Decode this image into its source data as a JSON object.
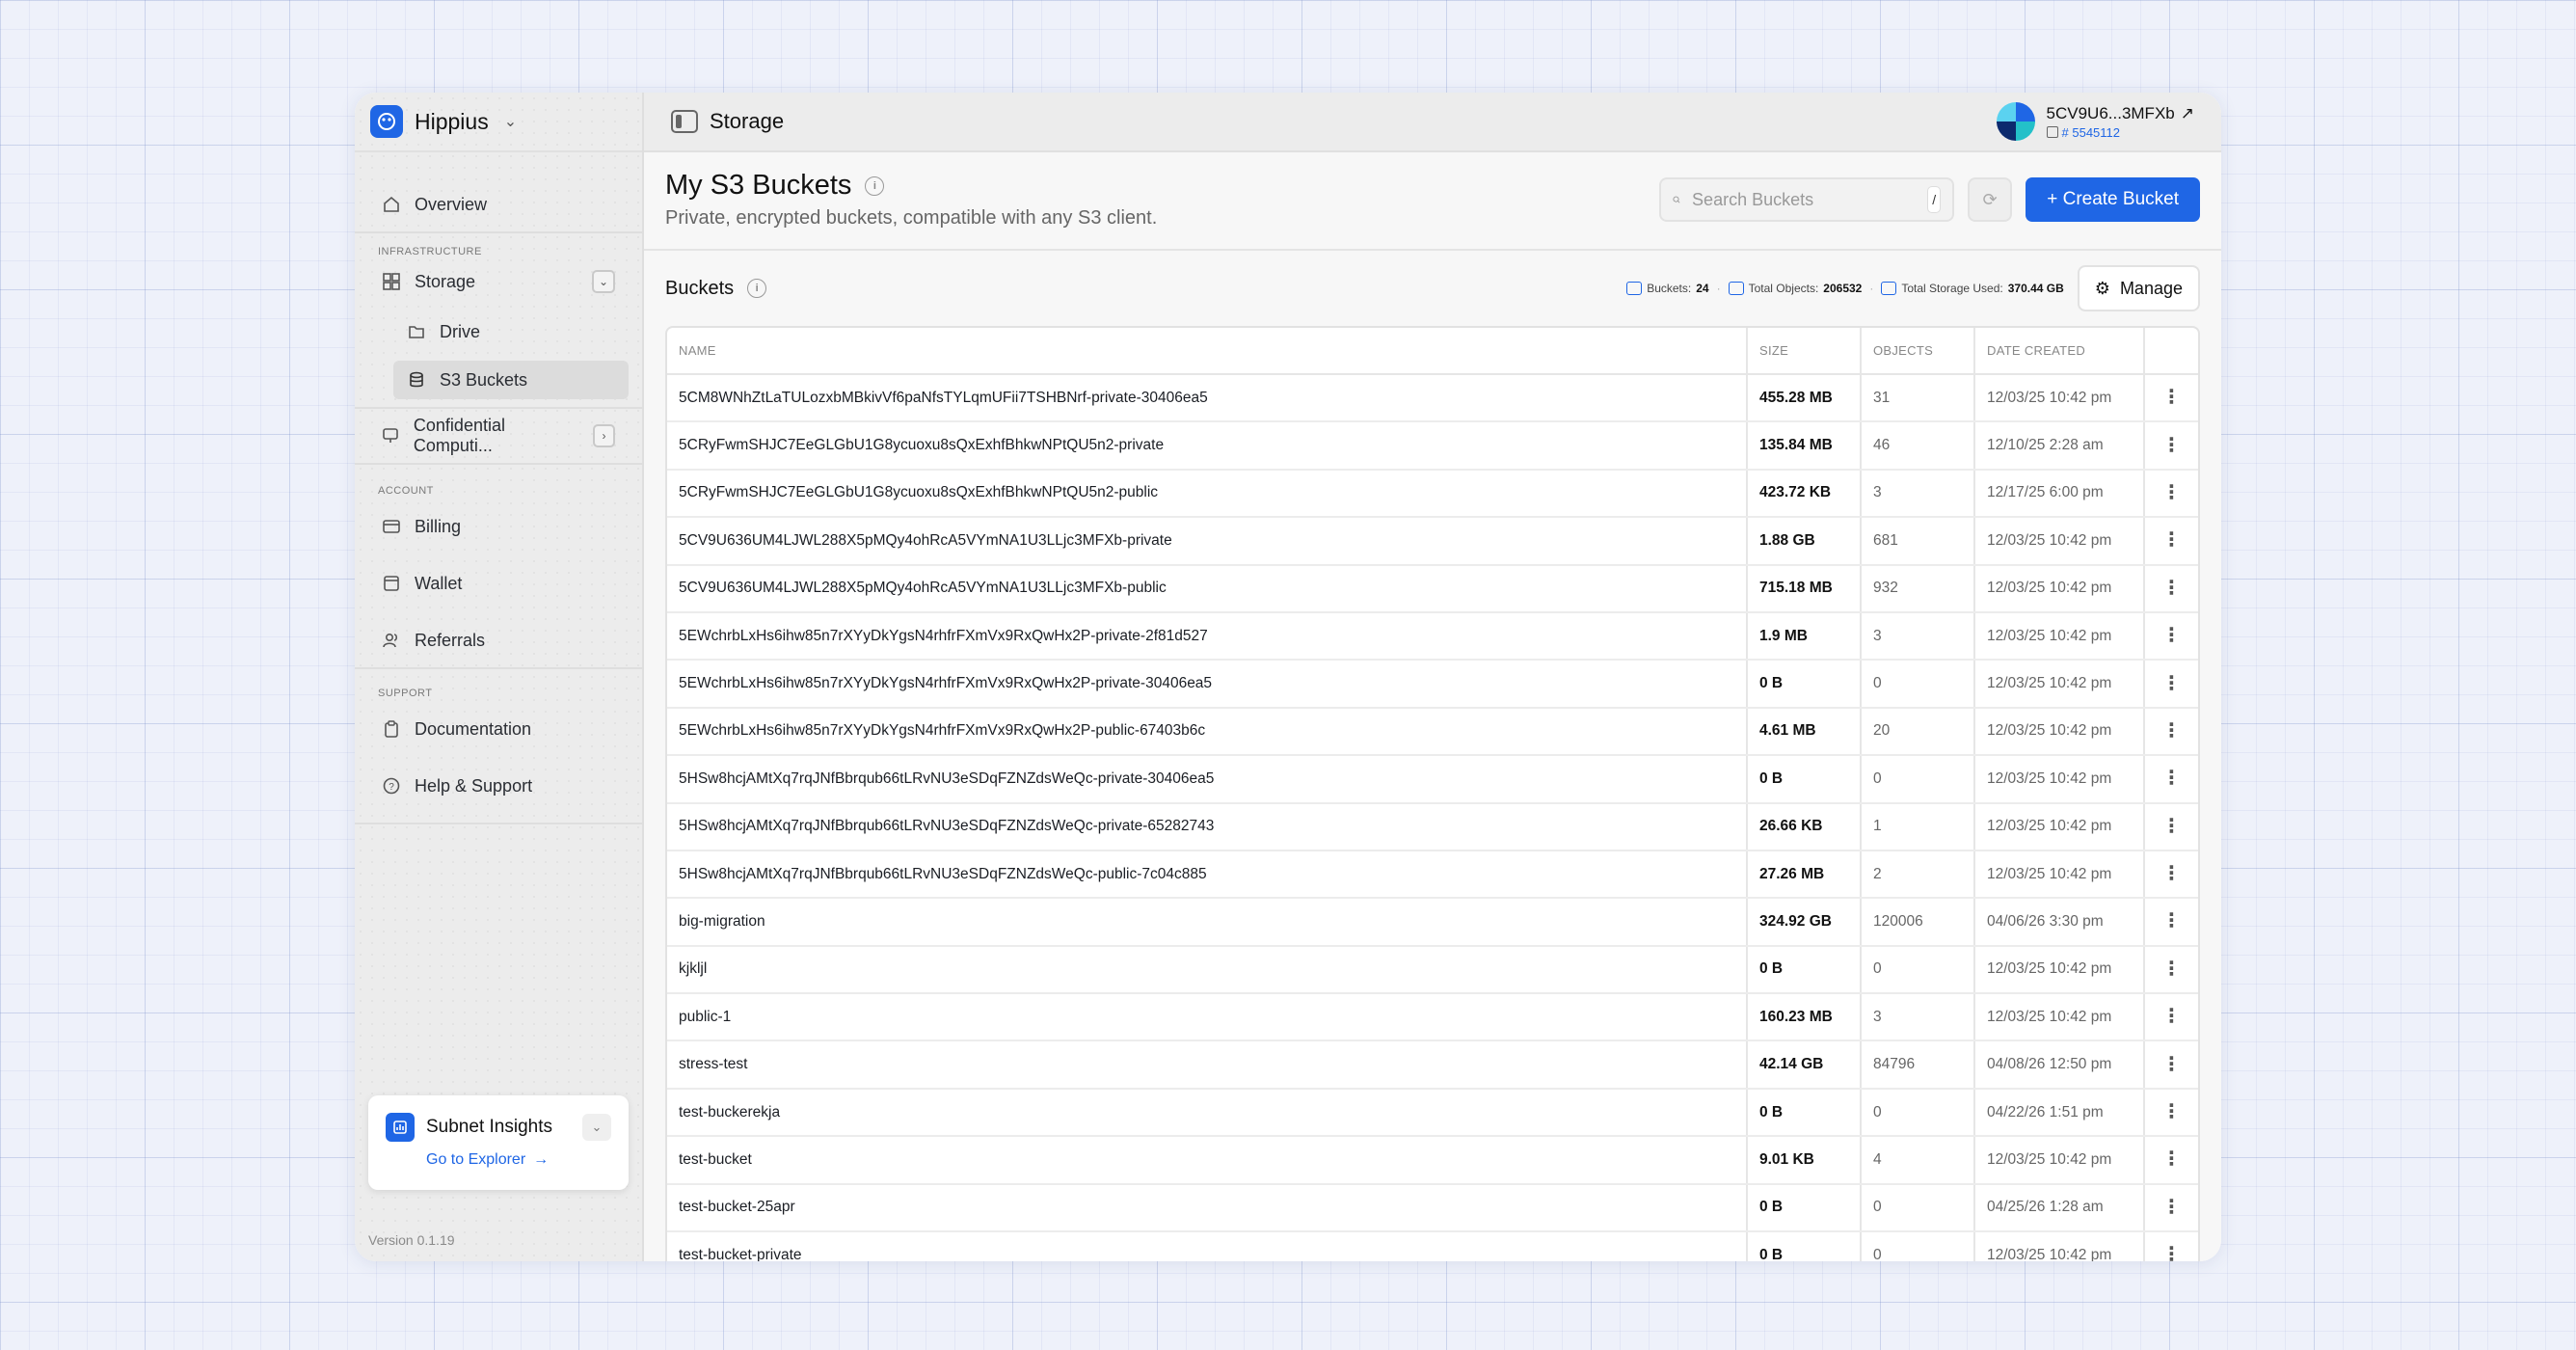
{
  "brand": {
    "name": "Hippius"
  },
  "topbar": {
    "title": "Storage",
    "account_name": "5CV9U6...3MFXb",
    "account_id": "# 5545112"
  },
  "sidebar": {
    "overview": "Overview",
    "infra_label": "INFRASTRUCTURE",
    "storage": "Storage",
    "drive": "Drive",
    "s3": "S3 Buckets",
    "confidential": "Confidential Computi...",
    "account_label": "ACCOUNT",
    "billing": "Billing",
    "wallet": "Wallet",
    "referrals": "Referrals",
    "support_label": "SUPPORT",
    "documentation": "Documentation",
    "help": "Help & Support",
    "insights_title": "Subnet Insights",
    "insights_link": "Go to Explorer",
    "version": "Version 0.1.19"
  },
  "header": {
    "title": "My S3 Buckets",
    "subtitle": "Private, encrypted buckets, compatible with any S3 client.",
    "search_placeholder": "Search Buckets",
    "search_key": "/",
    "create_label": "+ Create Bucket"
  },
  "subheader": {
    "title": "Buckets",
    "buckets_label": "Buckets:",
    "buckets_value": "24",
    "objects_label": "Total Objects:",
    "objects_value": "206532",
    "storage_label": "Total Storage Used:",
    "storage_value": "370.44 GB",
    "manage_label": "Manage"
  },
  "table": {
    "columns": [
      "NAME",
      "SIZE",
      "OBJECTS",
      "DATE CREATED"
    ],
    "rows": [
      [
        "5CM8WNhZtLaTULozxbMBkivVf6paNfsTYLqmUFii7TSHBNrf-private-30406ea5",
        "455.28 MB",
        "31",
        "12/03/25 10:42 pm"
      ],
      [
        "5CRyFwmSHJC7EeGLGbU1G8ycuoxu8sQxExhfBhkwNPtQU5n2-private",
        "135.84 MB",
        "46",
        "12/10/25 2:28 am"
      ],
      [
        "5CRyFwmSHJC7EeGLGbU1G8ycuoxu8sQxExhfBhkwNPtQU5n2-public",
        "423.72 KB",
        "3",
        "12/17/25 6:00 pm"
      ],
      [
        "5CV9U636UM4LJWL288X5pMQy4ohRcA5VYmNA1U3LLjc3MFXb-private",
        "1.88 GB",
        "681",
        "12/03/25 10:42 pm"
      ],
      [
        "5CV9U636UM4LJWL288X5pMQy4ohRcA5VYmNA1U3LLjc3MFXb-public",
        "715.18 MB",
        "932",
        "12/03/25 10:42 pm"
      ],
      [
        "5EWchrbLxHs6ihw85n7rXYyDkYgsN4rhfrFXmVx9RxQwHx2P-private-2f81d527",
        "1.9 MB",
        "3",
        "12/03/25 10:42 pm"
      ],
      [
        "5EWchrbLxHs6ihw85n7rXYyDkYgsN4rhfrFXmVx9RxQwHx2P-private-30406ea5",
        "0 B",
        "0",
        "12/03/25 10:42 pm"
      ],
      [
        "5EWchrbLxHs6ihw85n7rXYyDkYgsN4rhfrFXmVx9RxQwHx2P-public-67403b6c",
        "4.61 MB",
        "20",
        "12/03/25 10:42 pm"
      ],
      [
        "5HSw8hcjAMtXq7rqJNfBbrqub66tLRvNU3eSDqFZNZdsWeQc-private-30406ea5",
        "0 B",
        "0",
        "12/03/25 10:42 pm"
      ],
      [
        "5HSw8hcjAMtXq7rqJNfBbrqub66tLRvNU3eSDqFZNZdsWeQc-private-65282743",
        "26.66 KB",
        "1",
        "12/03/25 10:42 pm"
      ],
      [
        "5HSw8hcjAMtXq7rqJNfBbrqub66tLRvNU3eSDqFZNZdsWeQc-public-7c04c885",
        "27.26 MB",
        "2",
        "12/03/25 10:42 pm"
      ],
      [
        "big-migration",
        "324.92 GB",
        "120006",
        "04/06/26 3:30 pm"
      ],
      [
        "kjkljl",
        "0 B",
        "0",
        "12/03/25 10:42 pm"
      ],
      [
        "public-1",
        "160.23 MB",
        "3",
        "12/03/25 10:42 pm"
      ],
      [
        "stress-test",
        "42.14 GB",
        "84796",
        "04/08/26 12:50 pm"
      ],
      [
        "test-buckerekja",
        "0 B",
        "0",
        "04/22/26 1:51 pm"
      ],
      [
        "test-bucket",
        "9.01 KB",
        "4",
        "12/03/25 10:42 pm"
      ],
      [
        "test-bucket-25apr",
        "0 B",
        "0",
        "04/25/26 1:28 am"
      ],
      [
        "test-bucket-private",
        "0 B",
        "0",
        "12/03/25 10:42 pm"
      ]
    ]
  }
}
